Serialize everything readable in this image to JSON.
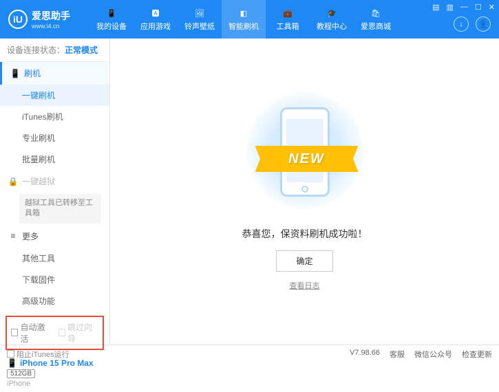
{
  "header": {
    "logo_text": "iU",
    "app_title": "爱思助手",
    "app_site": "www.i4.cn",
    "nav": [
      {
        "label": "我的设备"
      },
      {
        "label": "应用游戏"
      },
      {
        "label": "铃声壁纸"
      },
      {
        "label": "智能刷机"
      },
      {
        "label": "工具箱"
      },
      {
        "label": "教程中心"
      },
      {
        "label": "爱思商城"
      }
    ]
  },
  "status": {
    "label": "设备连接状态：",
    "value": "正常模式"
  },
  "sidebar": {
    "flash_group": "刷机",
    "items": {
      "one_key": "一键刷机",
      "itunes": "iTunes刷机",
      "pro": "专业刷机",
      "batch": "批量刷机"
    },
    "jailbreak_group": "一键越狱",
    "jailbreak_note": "越狱工具已转移至工具箱",
    "more_group": "更多",
    "more_items": {
      "other_tools": "其他工具",
      "download_fw": "下载固件",
      "advanced": "高级功能"
    },
    "checkboxes": {
      "auto_activate": "自动激活",
      "skip_guide": "跳过向导"
    },
    "device": {
      "name": "iPhone 15 Pro Max",
      "storage": "512GB",
      "type": "iPhone"
    }
  },
  "main": {
    "ribbon": "NEW",
    "success": "恭喜您，保资料刷机成功啦！",
    "ok": "确定",
    "view_log": "查看日志"
  },
  "footer": {
    "block_itunes": "阻止iTunes运行",
    "version": "V7.98.66",
    "links": {
      "service": "客服",
      "wechat": "微信公众号",
      "update": "检查更新"
    }
  }
}
